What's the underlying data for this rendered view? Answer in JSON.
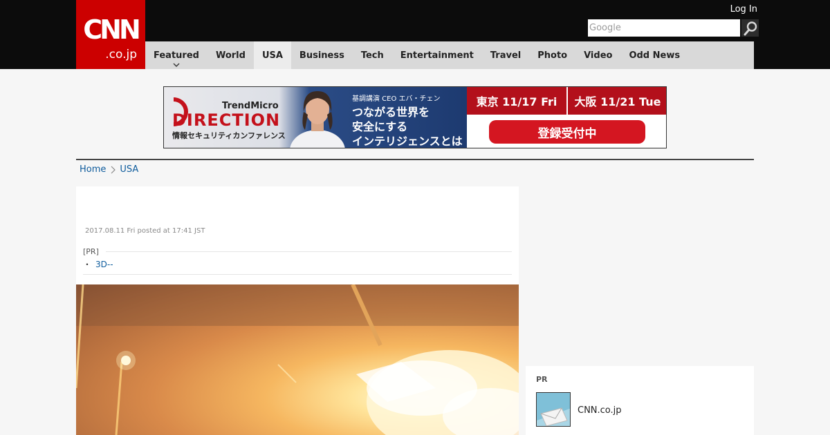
{
  "header": {
    "logo_main": "CNN",
    "logo_sub": ".co.jp",
    "login_label": "Log In",
    "search_placeholder": "Google"
  },
  "nav": {
    "items": [
      {
        "label": "Featured",
        "has_dropdown": true,
        "active": false
      },
      {
        "label": "World",
        "active": false
      },
      {
        "label": "USA",
        "active": true
      },
      {
        "label": "Business",
        "active": false
      },
      {
        "label": "Tech",
        "active": false
      },
      {
        "label": "Entertainment",
        "active": false
      },
      {
        "label": "Travel",
        "active": false
      },
      {
        "label": "Photo",
        "active": false
      },
      {
        "label": "Video",
        "active": false
      },
      {
        "label": "Odd News",
        "active": false
      }
    ]
  },
  "banner": {
    "brand": "TrendMicro",
    "title": "DIRECTION",
    "subtitle": "情報セキュリティカンファレンス",
    "keynote": "基調講演 CEO エバ・チェン",
    "headline_1": "つながる世界を",
    "headline_2": "安全にする",
    "headline_3": "インテリジェンスとは",
    "tokyo": "東京 11/17 Fri",
    "osaka": "大阪 11/21 Tue",
    "register": "登録受付中"
  },
  "breadcrumb": {
    "home": "Home",
    "current": "USA"
  },
  "article": {
    "date": "2017.08.11 Fri posted at 17:41 JST",
    "pr_label": "[PR]",
    "pr_link": "3D--"
  },
  "side_pr": {
    "label": "PR",
    "item_text": "CNN.co.jp"
  },
  "colors": {
    "brand_red": "#cc0000",
    "nav_bg": "#d9d9d9",
    "link_blue": "#0d5b9c"
  }
}
